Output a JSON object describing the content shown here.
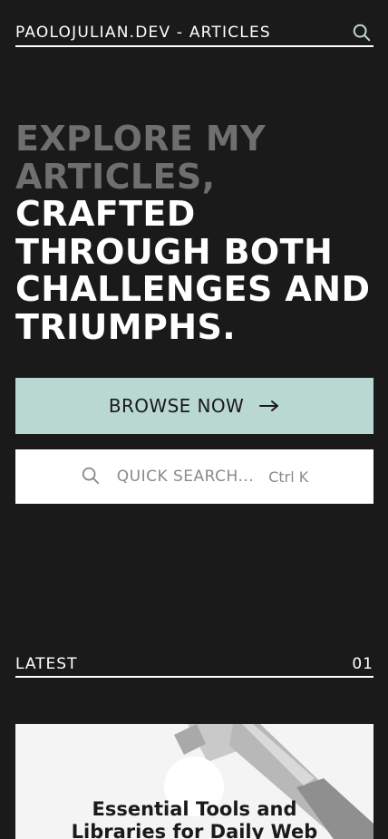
{
  "header": {
    "site_title": "PAOLOJULIAN.DEV - ARTICLES",
    "search_icon": "search-icon"
  },
  "hero": {
    "line1": "EXPLORE MY",
    "line2": "ARTICLES,",
    "line3": "CRAFTED",
    "line4": "THROUGH BOTH",
    "line5": "CHALLENGES AND",
    "line6": "TRIUMPHS."
  },
  "actions": {
    "browse_label": "BROWSE NOW",
    "browse_icon": "arrow-right-icon",
    "search_placeholder": "QUICK SEARCH...",
    "search_shortcut": "Ctrl K",
    "search_icon": "search-icon"
  },
  "latest": {
    "heading": "LATEST",
    "count": "01",
    "cards": [
      {
        "title": "Essential Tools and Libraries for Daily Web",
        "image_icon": "hammer-image"
      }
    ]
  },
  "colors": {
    "background": "#1a1a1a",
    "muted_text": "#6f6f6f",
    "accent": "#bad8d2",
    "foreground": "#ffffff"
  }
}
